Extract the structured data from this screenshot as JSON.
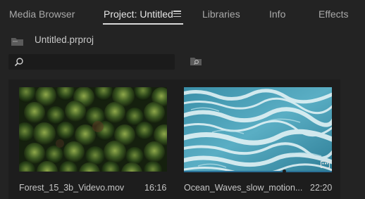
{
  "tabs": [
    {
      "label": "Media Browser",
      "active": false
    },
    {
      "label": "Project: Untitled",
      "active": true
    },
    {
      "label": "Libraries",
      "active": false
    },
    {
      "label": "Info",
      "active": false
    },
    {
      "label": "Effects",
      "active": false
    }
  ],
  "project": {
    "file_name": "Untitled.prproj",
    "folder_icon": "folder-icon"
  },
  "search": {
    "value": "",
    "placeholder": "",
    "icon": "search-icon"
  },
  "clips": [
    {
      "name": "Forest_15_3b_Videvo.mov",
      "duration": "16:16",
      "thumbnail": "forest-aerial"
    },
    {
      "name": "Ocean_Waves_slow_motion...",
      "duration": "22:20",
      "thumbnail": "ocean-waves"
    }
  ],
  "colors": {
    "background": "#232323",
    "panel": "#1d1d1d",
    "accent": "#2a6f95"
  }
}
